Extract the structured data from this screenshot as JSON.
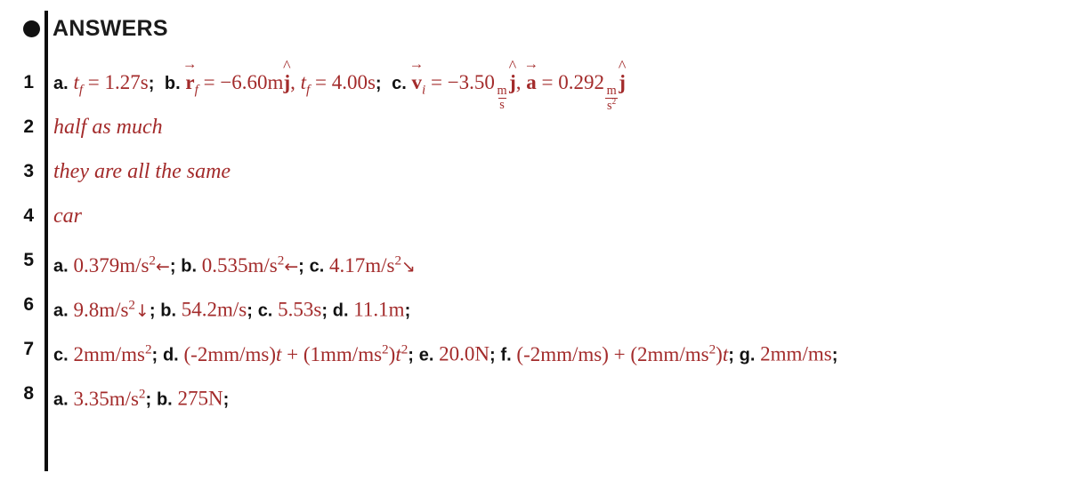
{
  "header": {
    "title": "ANSWERS",
    "bullet_icon": "filled-circle-bullet"
  },
  "colors": {
    "answer_red": "#a32b2b",
    "label_black": "#111111",
    "rule_black": "#0d0d0d",
    "page_background": "#ffffff"
  },
  "answers": [
    {
      "number": "1",
      "type": "math",
      "parts": [
        {
          "label": "a.",
          "value": "t_f = 1.27s;"
        },
        {
          "label": "b.",
          "value": "r_f = −6.60mĵ, t_f = 4.00s;"
        },
        {
          "label": "c.",
          "value": "v_i = −3.50 m/s ĵ, a = 0.292 m/s² ĵ"
        }
      ],
      "plain_text": "a. t_f = 1.27s;  b. r⃗_f = −6.60mĵ, t_f = 4.00s;  c. v⃗_i = −3.50 m/s ĵ, a⃗ = 0.292 m/s² ĵ"
    },
    {
      "number": "2",
      "type": "prose",
      "text": "half as much"
    },
    {
      "number": "3",
      "type": "prose",
      "text": "they are all the same"
    },
    {
      "number": "4",
      "type": "prose",
      "text": "car"
    },
    {
      "number": "5",
      "type": "math",
      "parts": [
        {
          "label": "a.",
          "value": "0.379m/s²←;"
        },
        {
          "label": "b.",
          "value": "0.535m/s²←;"
        },
        {
          "label": "c.",
          "value": "4.17m/s²↘"
        }
      ],
      "plain_text": "a. 0.379m/s²←; b. 0.535m/s²←; c. 4.17m/s²↘"
    },
    {
      "number": "6",
      "type": "math",
      "parts": [
        {
          "label": "a.",
          "value": "9.8m/s²↓;"
        },
        {
          "label": "b.",
          "value": "54.2m/s;"
        },
        {
          "label": "c.",
          "value": "5.53s;"
        },
        {
          "label": "d.",
          "value": "11.1m;"
        }
      ],
      "plain_text": "a. 9.8m/s²↓; b. 54.2m/s; c. 5.53s; d. 11.1m;"
    },
    {
      "number": "7",
      "type": "math",
      "parts": [
        {
          "label": "c.",
          "value": "2mm/ms²;"
        },
        {
          "label": "d.",
          "value": "(-2mm/ms)t + (1mm/ms²)t²;"
        },
        {
          "label": "e.",
          "value": "20.0N;"
        },
        {
          "label": "f.",
          "value": "(-2mm/ms) + (2mm/ms²)t;"
        },
        {
          "label": "g.",
          "value": "2mm/ms;"
        }
      ],
      "plain_text": "c. 2mm/ms²; d. (-2mm/ms)t + (1mm/ms²)t²; e. 20.0N; f. (-2mm/ms) + (2mm/ms²)t; g. 2mm/ms;"
    },
    {
      "number": "8",
      "type": "math",
      "parts": [
        {
          "label": "a.",
          "value": "3.35m/s²;"
        },
        {
          "label": "b.",
          "value": "275N;"
        }
      ],
      "plain_text": "a. 3.35m/s²; b. 275N;"
    }
  ],
  "symbols": {
    "left_arrow": "←",
    "down_arrow": "↓",
    "down_right_arrow": "↘",
    "minus": "−",
    "equals": "=",
    "plus": "+"
  }
}
